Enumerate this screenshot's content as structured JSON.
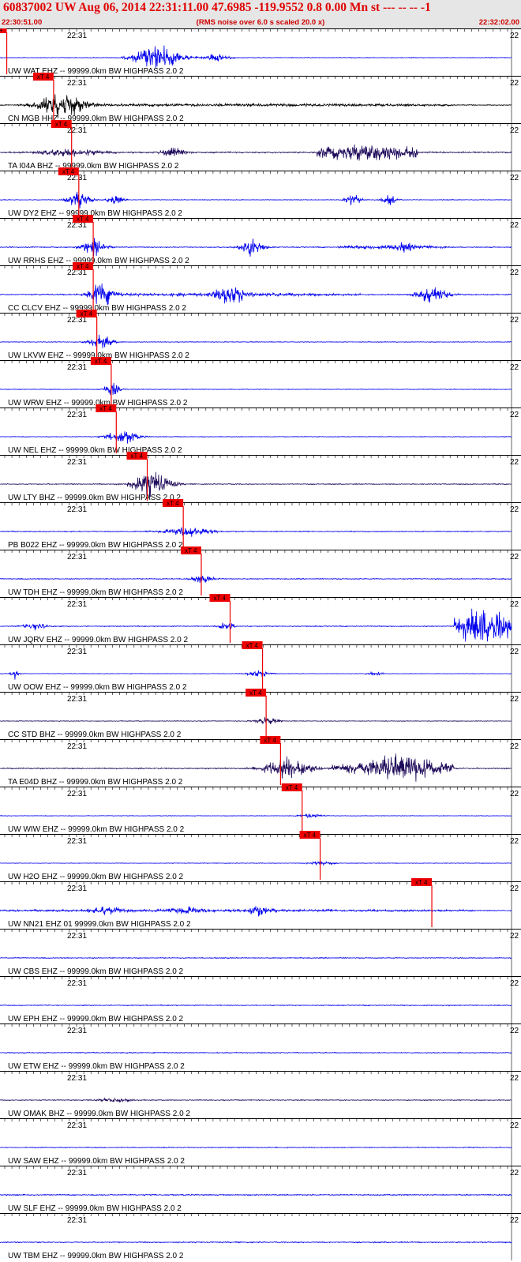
{
  "header": {
    "title": "60837002 UW Aug 06, 2014 22:31:11.00   47.6985 -119.9552  0.8 0.00 Mn st --- -- --  -1",
    "subtitle": "(RMS noise over 6.0 s scaled 20.0 x)",
    "start_time": "22:30:51.00",
    "end_time": "22:32:02.00"
  },
  "chart_data": {
    "type": "line",
    "title": "60837002 UW Aug 06, 2014 22:31:11.00   47.6985 -119.9552  0.8 0.00 Mn st --- -- --  -1",
    "xlim": [
      "22:30:51.00",
      "22:32:02.00"
    ],
    "time_tick_label": "22:31",
    "right_tick_label": "22",
    "pick_flag_label": "xT 4",
    "colors": {
      "blue": "#0000ee",
      "dark": "#1e0a5a",
      "black": "#000000",
      "pick": "#ee0000",
      "header_bg": "#e6e6e6"
    },
    "traces": [
      {
        "label": "UW WAT EHZ -- 99999.0km BW  HIGHPASS  2.0  2",
        "color": "blue",
        "pick_s": 0.5,
        "events": [
          [
            22,
            6,
            5.5
          ],
          [
            30,
            3,
            2.0
          ]
        ],
        "bursts": [],
        "noise": 0.15
      },
      {
        "label": "CN MGB HHZ -- 99999.0km BW  HIGHPASS  2.0  2",
        "color": "black",
        "pick_s": 7.0,
        "events": [
          [
            8.5,
            6,
            5.5
          ]
        ],
        "bursts": [
          [
            9,
            63,
            0.4
          ]
        ],
        "noise": 0.2
      },
      {
        "label": "TA I04A BHZ -- 99999.0km BW  HIGHPASS  2.0  2",
        "color": "dark",
        "pick_s": 9.5,
        "events": [
          [
            10,
            8,
            1.5
          ],
          [
            24,
            3,
            2.0
          ]
        ],
        "bursts": [
          [
            44,
            58,
            3.5
          ]
        ],
        "noise": 0.3
      },
      {
        "label": "UW DY2 EHZ -- 99999.0km BW  HIGHPASS  2.0  2",
        "color": "blue",
        "pick_s": 10.5,
        "events": [
          [
            11,
            3,
            3.5
          ],
          [
            16,
            2,
            2.0
          ],
          [
            49,
            2,
            2.5
          ],
          [
            54,
            2,
            2.0
          ]
        ],
        "bursts": [],
        "noise": 0.15
      },
      {
        "label": "UW RRHS EHZ -- 99999.0km BW  HIGHPASS  2.0  2",
        "color": "blue",
        "pick_s": 12.5,
        "events": [
          [
            13,
            3,
            4.0
          ],
          [
            35,
            3,
            4.0
          ],
          [
            56,
            3,
            1.5
          ]
        ],
        "bursts": [
          [
            47,
            62,
            0.6
          ]
        ],
        "noise": 0.2
      },
      {
        "label": "CC CLCV EHZ -- 99999.0km BW  HIGHPASS  2.0  2",
        "color": "blue",
        "pick_s": 12.5,
        "events": [
          [
            14,
            3,
            6.0
          ],
          [
            32,
            4,
            4.0
          ],
          [
            60,
            4,
            3.5
          ]
        ],
        "bursts": [
          [
            13,
            50,
            0.5
          ]
        ],
        "noise": 0.25
      },
      {
        "label": "UW LKVW EHZ -- 99999.0km BW  HIGHPASS  2.0  2",
        "color": "blue",
        "pick_s": 13.0,
        "events": [
          [
            14,
            3,
            3.0
          ]
        ],
        "bursts": [],
        "noise": 0.15
      },
      {
        "label": "UW WRW EHZ -- 99999.0km BW  HIGHPASS  2.0  2",
        "color": "blue",
        "pick_s": 15.0,
        "events": [
          [
            15.5,
            2,
            3.0
          ]
        ],
        "bursts": [],
        "noise": 0.15
      },
      {
        "label": "UW NEL EHZ -- 99999.0km BW  HIGHPASS  2.0  2",
        "color": "blue",
        "pick_s": 15.7,
        "events": [
          [
            17,
            4,
            3.0
          ]
        ],
        "bursts": [],
        "noise": 0.15
      },
      {
        "label": "UW LTY BHZ -- 99999.0km BW  HIGHPASS  2.0  2",
        "color": "dark",
        "pick_s": 20.0,
        "events": [
          [
            21,
            5,
            5.5
          ]
        ],
        "bursts": [],
        "noise": 0.2
      },
      {
        "label": "PB B022 EHZ -- 99999.0km BW  HIGHPASS  2.0  2",
        "color": "blue",
        "pick_s": 25.0,
        "events": [
          [
            26,
            6,
            2.0
          ]
        ],
        "bursts": [],
        "noise": 0.2
      },
      {
        "label": "UW TDH EHZ -- 99999.0km BW  HIGHPASS  2.0  2",
        "color": "blue",
        "pick_s": 27.5,
        "events": [
          [
            28,
            3,
            1.5
          ]
        ],
        "bursts": [],
        "noise": 0.2
      },
      {
        "label": "UW JQRV EHZ -- 99999.0km BW  HIGHPASS  2.0  2",
        "color": "blue",
        "pick_s": 31.5,
        "events": [
          [
            5,
            3,
            1.5
          ],
          [
            31.5,
            2,
            2.0
          ]
        ],
        "bursts": [
          [
            63,
            71,
            8.0
          ]
        ],
        "noise": 0.2
      },
      {
        "label": "UW OOW EHZ -- 99999.0km BW  HIGHPASS  2.0  2",
        "color": "blue",
        "pick_s": 36.0,
        "events": [
          [
            2,
            1,
            2.5
          ],
          [
            36,
            3,
            1.5
          ],
          [
            52,
            2,
            1.0
          ]
        ],
        "bursts": [],
        "noise": 0.12
      },
      {
        "label": "CC STD BHZ -- 99999.0km BW  HIGHPASS  2.0  2",
        "color": "dark",
        "pick_s": 36.5,
        "events": [
          [
            37,
            3,
            1.5
          ]
        ],
        "bursts": [],
        "noise": 0.15
      },
      {
        "label": "TA E04D BHZ -- 99999.0km BW  HIGHPASS  2.0  2",
        "color": "dark",
        "pick_s": 38.5,
        "events": [
          [
            40,
            6,
            5.0
          ],
          [
            56,
            7,
            3.5
          ]
        ],
        "bursts": [
          [
            46,
            63,
            3.0
          ]
        ],
        "noise": 0.25
      },
      {
        "label": "UW WIW EHZ -- 99999.0km BW  HIGHPASS  2.0  2",
        "color": "blue",
        "pick_s": 41.5,
        "events": [
          [
            43,
            3,
            1.0
          ]
        ],
        "bursts": [],
        "noise": 0.12
      },
      {
        "label": "UW H2O EHZ -- 99999.0km BW  HIGHPASS  2.0  2",
        "color": "blue",
        "pick_s": 44.0,
        "events": [
          [
            44.5,
            3,
            1.0
          ]
        ],
        "bursts": [],
        "noise": 0.12
      },
      {
        "label": "UW NN21 EHZ 01 99999.0km BW  HIGHPASS  2.0  2",
        "color": "blue",
        "pick_s": 59.5,
        "events": [
          [
            15,
            4,
            1.5
          ],
          [
            26,
            4,
            1.5
          ],
          [
            36,
            3,
            2.0
          ]
        ],
        "bursts": [
          [
            0,
            66,
            0.3
          ]
        ],
        "noise": 0.2
      },
      {
        "label": "UW CBS EHZ -- 99999.0km BW  HIGHPASS  2.0  2",
        "color": "blue",
        "pick_s": null,
        "events": [],
        "bursts": [],
        "noise": 0.2
      },
      {
        "label": "UW EPH EHZ -- 99999.0km BW  HIGHPASS  2.0  2",
        "color": "blue",
        "pick_s": null,
        "events": [],
        "bursts": [],
        "noise": 0.2
      },
      {
        "label": "UW ETW EHZ -- 99999.0km BW  HIGHPASS  2.0  2",
        "color": "blue",
        "pick_s": null,
        "events": [],
        "bursts": [],
        "noise": 0.2
      },
      {
        "label": "UW OMAK BHZ -- 99999.0km BW  HIGHPASS  2.0  2",
        "color": "dark",
        "pick_s": null,
        "events": [
          [
            16,
            4,
            1.0
          ]
        ],
        "bursts": [],
        "noise": 0.2
      },
      {
        "label": "UW SAW EHZ -- 99999.0km BW  HIGHPASS  2.0  2",
        "color": "blue",
        "pick_s": null,
        "events": [],
        "bursts": [],
        "noise": 0.2
      },
      {
        "label": "UW SLF EHZ -- 99999.0km BW  HIGHPASS  2.0  2",
        "color": "blue",
        "pick_s": null,
        "events": [],
        "bursts": [],
        "noise": 0.25
      },
      {
        "label": "UW TBM EHZ -- 99999.0km BW  HIGHPASS  2.0  2",
        "color": "blue",
        "pick_s": null,
        "events": [],
        "bursts": [],
        "noise": 0.25
      }
    ]
  }
}
